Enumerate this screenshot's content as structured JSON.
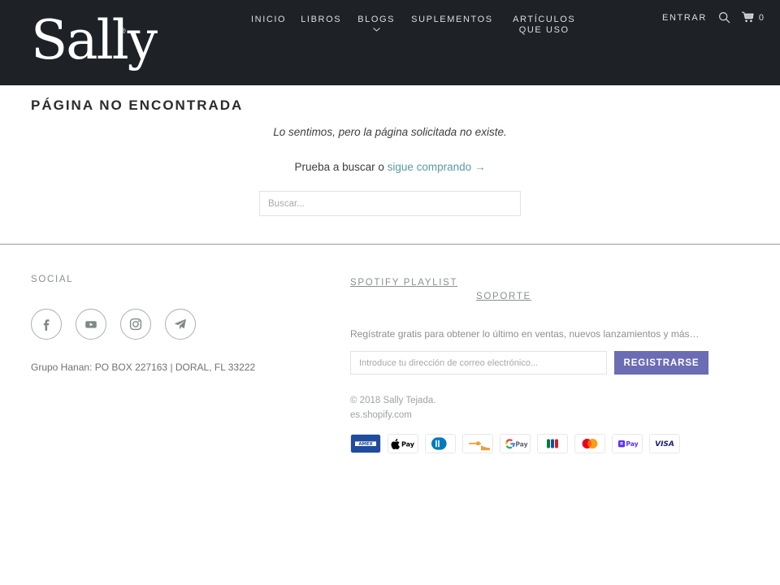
{
  "header": {
    "logo_text": "Sally",
    "logo_mark": "®",
    "nav": [
      {
        "label": "INICIO",
        "has_chevron": false
      },
      {
        "label": "LIBROS",
        "has_chevron": false
      },
      {
        "label": "BLOGS",
        "has_chevron": true,
        "chevron_icon": "chevron-down-icon"
      },
      {
        "label": "SUPLEMENTOS",
        "has_chevron": false
      },
      {
        "label": "ARTÍCULOS QUE USO",
        "has_chevron": false
      }
    ],
    "account_label": "ENTRAR",
    "search_icon": "search-icon",
    "cart_icon": "cart-icon",
    "cart_count": "0",
    "background_color": "#1e2227",
    "text_color": "#dcdee0"
  },
  "main": {
    "page_title": "PÁGINA NO ENCONTRADA",
    "message": "Lo sentimos, pero la página solicitada no existe.",
    "try_prefix": "Prueba a buscar o ",
    "continue_link": "sigue comprando →",
    "link_color": "#5b9aa4",
    "search_placeholder": "Buscar...",
    "search_value": ""
  },
  "footer": {
    "social": {
      "heading": "SOCIAL",
      "icons": [
        {
          "name": "facebook-icon",
          "label": "Facebook"
        },
        {
          "name": "youtube-icon",
          "label": "YouTube"
        },
        {
          "name": "instagram-icon",
          "label": "Instagram"
        },
        {
          "name": "telegram-icon",
          "label": "Telegram"
        }
      ],
      "address": "Grupo Hanan: PO BOX 227163 | DORAL, FL 33222"
    },
    "links": {
      "spotify_heading": "SPOTIFY PLAYLIST",
      "support_heading": "SOPORTE"
    },
    "newsletter": {
      "text": "Regístrate gratis para obtener lo último en ventas, nuevos lanzamientos y más…",
      "email_placeholder": "Introduce tu dirección de correo electrónico...",
      "email_value": "",
      "button_label": "REGISTRARSE",
      "button_color": "#6c6cb4"
    },
    "copyright": {
      "line1": "© 2018 Sally Tejada.",
      "line2": "es.shopify.com"
    },
    "payment_methods": [
      {
        "name": "amex-icon",
        "label": "American Express"
      },
      {
        "name": "apple-pay-icon",
        "label": "Apple Pay"
      },
      {
        "name": "diners-club-icon",
        "label": "Diners Club"
      },
      {
        "name": "discover-icon",
        "label": "Discover"
      },
      {
        "name": "google-pay-icon",
        "label": "Google Pay"
      },
      {
        "name": "jcb-icon",
        "label": "JCB"
      },
      {
        "name": "mastercard-icon",
        "label": "Mastercard"
      },
      {
        "name": "shop-pay-icon",
        "label": "Shop Pay"
      },
      {
        "name": "visa-icon",
        "label": "Visa"
      }
    ]
  }
}
